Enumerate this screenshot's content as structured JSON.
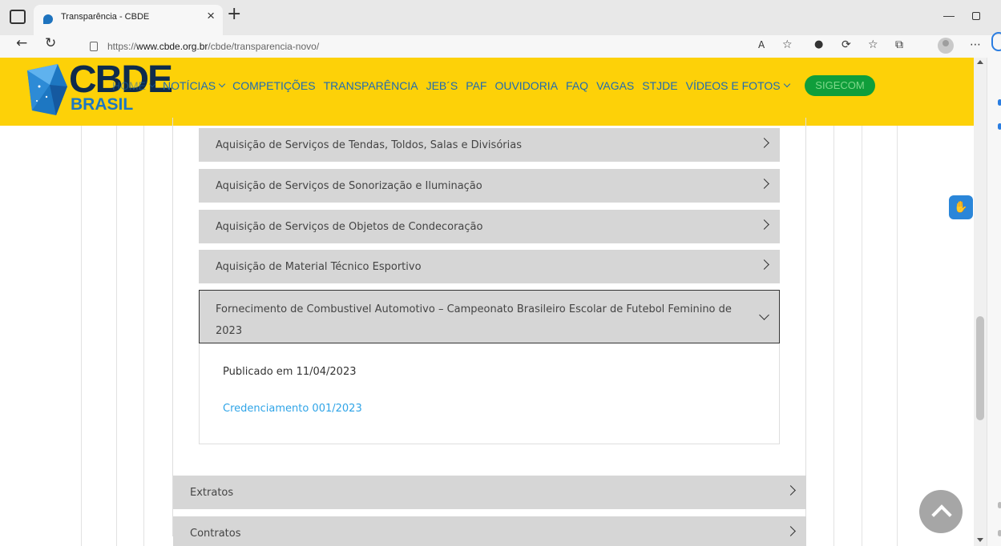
{
  "browser": {
    "tab_title": "Transparência - CBDE",
    "tab_close": "×",
    "new_tab": "+",
    "url_prefix": "https://",
    "url_host": "www.cbde.org.br",
    "url_path": "/cbde/transparencia-novo/",
    "window_minimize": "—"
  },
  "site": {
    "logo_text": "CBDE",
    "logo_sub": "BRASIL",
    "nav": [
      {
        "label": "HOME",
        "has_dropdown": true
      },
      {
        "label": "NOTÍCIAS",
        "has_dropdown": true
      },
      {
        "label": "COMPETIÇÕES",
        "has_dropdown": false
      },
      {
        "label": "TRANSPARÊNCIA",
        "has_dropdown": false
      },
      {
        "label": "JEB´S",
        "has_dropdown": false
      },
      {
        "label": "PAF",
        "has_dropdown": false
      },
      {
        "label": "OUVIDORIA",
        "has_dropdown": false
      },
      {
        "label": "FAQ",
        "has_dropdown": false
      },
      {
        "label": "VAGAS",
        "has_dropdown": false
      },
      {
        "label": "STJDE",
        "has_dropdown": false
      },
      {
        "label": "VÍDEOS E FOTOS",
        "has_dropdown": true
      }
    ],
    "sigecom_label": "SIGECOM",
    "colors": {
      "header": "#fdd108",
      "nav_text": "#1d6bb3",
      "sigecom": "#0f9e3b",
      "link": "#2fa4e7",
      "accordion": "#d6d6d6"
    }
  },
  "accordion": {
    "items": [
      "Aquisição de Serviços de Tendas, Toldos, Salas e Divisórias",
      "Aquisição de Serviços de Sonorização e Iluminação",
      "Aquisição de Serviços de Objetos de Condecoração",
      "Aquisição de Material Técnico Esportivo"
    ],
    "open_item": {
      "title": "Fornecimento de Combustivel Automotivo – Campeonato Brasileiro Escolar de Futebol Feminino de 2023",
      "published": "Publicado em 11/04/2023",
      "link": "Credenciamento 001/2023"
    }
  },
  "sections": [
    "Extratos",
    "Contratos"
  ]
}
